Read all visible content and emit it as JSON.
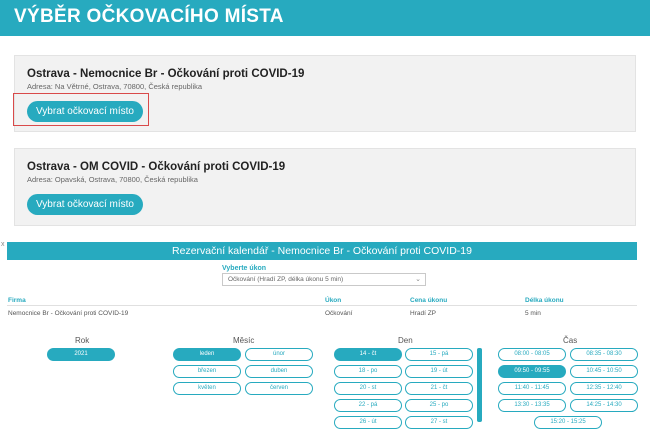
{
  "header": {
    "title": "VÝBĚR OČKOVACÍHO MÍSTA"
  },
  "locations": [
    {
      "title": "Ostrava - Nemocnice Br - Očkování proti COVID-19",
      "address": "Adresa: Na Větrné, Ostrava, 70800, Česká republika",
      "button": "Vybrat očkovací místo"
    },
    {
      "title": "Ostrava - OM COVID - Očkování proti COVID-19",
      "address": "Adresa: Opavská, Ostrava, 70800, Česká republika",
      "button": "Vybrat očkovací místo"
    }
  ],
  "calendar": {
    "close": "x",
    "title": "Rezervační kalendář - Nemocnice Br - Očkování proti COVID-19",
    "select_label": "Vyberte úkon",
    "select_value": "Očkování (Hradí ZP, délka úkonu 5 min)",
    "select_arrow": "⌄",
    "table": {
      "headers": [
        "Firma",
        "Úkon",
        "Cena úkonu",
        "Délka úkonu"
      ],
      "row": [
        "Nemocnice Br - Očkování proti COVID-19",
        "Očkování",
        "Hradí ZP",
        "5 min"
      ]
    },
    "year_label": "Rok",
    "years": [
      "2021"
    ],
    "month_label": "Měsíc",
    "months": [
      "leden",
      "únor",
      "březen",
      "duben",
      "květen",
      "červen"
    ],
    "day_label": "Den",
    "days": [
      "14 - čt",
      "15 - pá",
      "18 - po",
      "19 - út",
      "20 - st",
      "21 - čt",
      "22 - pá",
      "25 - po",
      "26 - út",
      "27 - st"
    ],
    "time_label": "Čas",
    "times": [
      "08:00 - 08:05",
      "08:35 - 08:30",
      "09:50 - 09:55",
      "10:45 - 10:50",
      "11:40 - 11:45",
      "12:35 - 12:40",
      "13:30 - 13:35",
      "14:25 - 14:30",
      "15:20 - 15:25"
    ],
    "scroll_position": 0.0
  }
}
